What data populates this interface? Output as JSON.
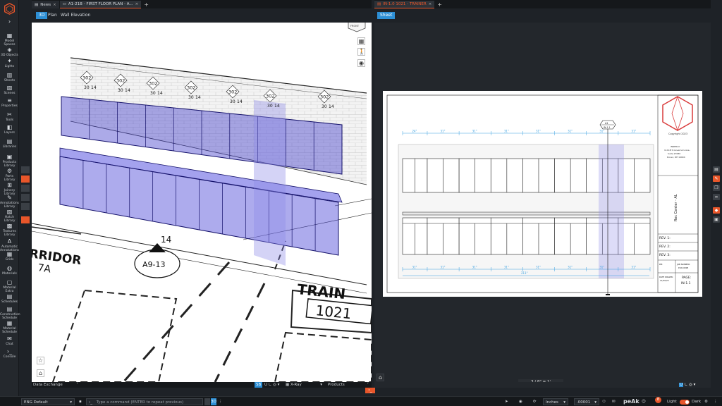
{
  "sidebar": {
    "items": [
      {
        "label": "Model Spaces",
        "icon": "grid-icon"
      },
      {
        "label": "3D Objects",
        "icon": "cube-icon"
      },
      {
        "label": "Lights",
        "icon": "light-icon"
      },
      {
        "label": "Sheets",
        "icon": "book-icon"
      },
      {
        "label": "Scenes",
        "icon": "scenes-icon"
      },
      {
        "label": "Properties",
        "icon": "properties-icon"
      },
      {
        "label": "Tools",
        "icon": "tools-icon"
      },
      {
        "label": "Layers",
        "icon": "layers-icon"
      },
      {
        "label": "Libraries",
        "icon": "libraries-icon"
      },
      {
        "label": "Products Library",
        "icon": "products-icon"
      },
      {
        "label": "Parts Library",
        "icon": "parts-icon"
      },
      {
        "label": "Joinery Library",
        "icon": "joinery-icon"
      },
      {
        "label": "Annotations Library",
        "icon": "annotations-icon"
      },
      {
        "label": "Hatch Library",
        "icon": "hatch-icon"
      },
      {
        "label": "Textures Library",
        "icon": "textures-icon"
      },
      {
        "label": "Automatic Annotations",
        "icon": "auto-annotations-icon"
      },
      {
        "label": "Grids",
        "icon": "grids-icon"
      },
      {
        "label": "Materials",
        "icon": "materials-icon"
      },
      {
        "label": "Material Extra",
        "icon": "material-extra-icon"
      },
      {
        "label": "Schedules",
        "icon": "schedules-icon"
      },
      {
        "label": "Construction Schedule",
        "icon": "construction-icon"
      },
      {
        "label": "Material Schedule",
        "icon": "material-schedule-icon"
      },
      {
        "label": "Chat",
        "icon": "chat-icon"
      },
      {
        "label": "Console",
        "icon": "console-icon"
      }
    ]
  },
  "left_pane": {
    "tabs": [
      {
        "label": "News"
      },
      {
        "label": "A1-21B - FIRST FLOOR PLAN - A..."
      }
    ],
    "views": [
      "3D",
      "Plan",
      "Wall Elevation"
    ],
    "active_view": "3D",
    "viewcube_label": "FRONT",
    "bottom": {
      "data_exchange": "Data Exchange",
      "xray": "X-Ray",
      "products": "Products",
      "sb": "SB"
    },
    "plan_labels": {
      "corridor": "RRIDOR",
      "corridor_tag": "7A",
      "section_tag": "A9-13",
      "dim_14": "14",
      "room_name": "TRAIN",
      "room_number": "1021"
    },
    "diamond_tags": [
      "302",
      "302",
      "302",
      "302",
      "302",
      "302",
      "302"
    ],
    "tag_values": [
      "30",
      "14",
      "24"
    ]
  },
  "right_pane": {
    "tabs": [
      {
        "label": "IN-1.0 1021 - TRAINER"
      }
    ],
    "views": [
      "Sheet"
    ],
    "scale": "3 / 8\" = 1'",
    "sheet": {
      "copyright": "Copyright 2023",
      "company": "INNERGY",
      "address": [
        "1111B S Governors Ave.,",
        "Suite 27680",
        "Dover, DE 19904"
      ],
      "project": "Rec Center - AL",
      "revs": [
        "REV. 1:",
        "REV. 2:",
        "REV. 3:"
      ],
      "job_label": "JOB NUMBER:",
      "job_number": "P-00-0095",
      "date_label": "DATE DRAWN:",
      "date_value": "11/20/23",
      "page_label": "PAGE:",
      "page_value": "IN-1.1",
      "dims_top": [
        "24\"",
        "31\"",
        "31\"",
        "31\"",
        "31\"",
        "31\"",
        "31\"",
        "31\""
      ],
      "dims_bottom": [
        "31\"",
        "31\"",
        "31\"",
        "31\"",
        "31\"",
        "31\"",
        "31\"",
        "31\""
      ],
      "overall_dim": "211\"",
      "section_mark_top": "A1",
      "section_mark_bottom": "IN-1.1"
    }
  },
  "statusbar": {
    "language": "ENG Default",
    "command_placeholder": "Type a command (ENTER to repeat previous)",
    "units": "Inches",
    "precision": ".00001",
    "brand": "peAk",
    "notif_count": "8",
    "theme_light": "Light",
    "theme_dark": "Dark"
  },
  "colors": {
    "accent": "#e8562a",
    "active_view": "#2d8fd5",
    "cabinet_blue": "#3b36c9"
  }
}
